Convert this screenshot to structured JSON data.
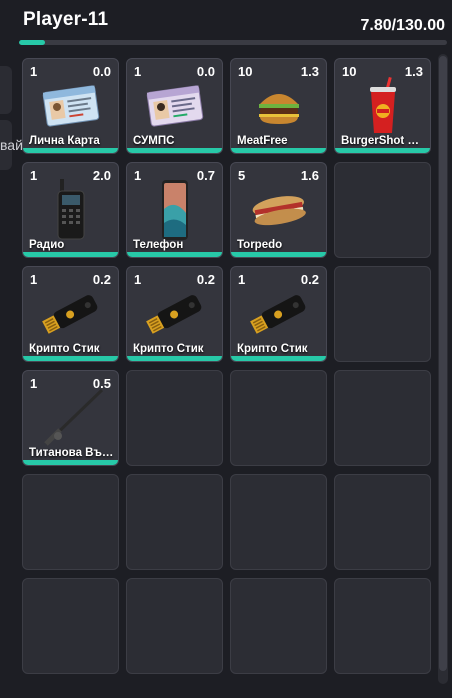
{
  "player": {
    "name": "Player-11",
    "weight": "7.80/130.00",
    "weight_fraction": 0.06
  },
  "side_label": "вай",
  "colors": {
    "accent": "#27c9a8",
    "slot_bg": "#2c2d34",
    "background": "#1d1e24"
  },
  "slots": [
    {
      "filled": true,
      "qty": "1",
      "weight": "0.0",
      "name": "Лична Карта",
      "icon": "id-card-icon"
    },
    {
      "filled": true,
      "qty": "1",
      "weight": "0.0",
      "name": "СУМПС",
      "icon": "driver-license-icon"
    },
    {
      "filled": true,
      "qty": "10",
      "weight": "1.3",
      "name": "MeatFree",
      "icon": "burger-icon"
    },
    {
      "filled": true,
      "qty": "10",
      "weight": "1.3",
      "name": "BurgerShot K…",
      "icon": "drink-cup-icon"
    },
    {
      "filled": true,
      "qty": "1",
      "weight": "2.0",
      "name": "Радио",
      "icon": "radio-icon"
    },
    {
      "filled": true,
      "qty": "1",
      "weight": "0.7",
      "name": "Телефон",
      "icon": "phone-icon"
    },
    {
      "filled": true,
      "qty": "5",
      "weight": "1.6",
      "name": "Torpedo",
      "icon": "sandwich-icon"
    },
    {
      "filled": false
    },
    {
      "filled": true,
      "qty": "1",
      "weight": "0.2",
      "name": "Крипто Стик",
      "icon": "usb-stick-icon"
    },
    {
      "filled": true,
      "qty": "1",
      "weight": "0.2",
      "name": "Крипто Стик",
      "icon": "usb-stick-icon"
    },
    {
      "filled": true,
      "qty": "1",
      "weight": "0.2",
      "name": "Крипто Стик",
      "icon": "usb-stick-icon"
    },
    {
      "filled": false
    },
    {
      "filled": true,
      "qty": "1",
      "weight": "0.5",
      "name": "Титанова Въ…",
      "icon": "fishing-rod-icon"
    },
    {
      "filled": false
    },
    {
      "filled": false
    },
    {
      "filled": false
    },
    {
      "filled": false
    },
    {
      "filled": false
    },
    {
      "filled": false
    },
    {
      "filled": false
    },
    {
      "filled": false
    },
    {
      "filled": false
    },
    {
      "filled": false
    },
    {
      "filled": false
    }
  ]
}
